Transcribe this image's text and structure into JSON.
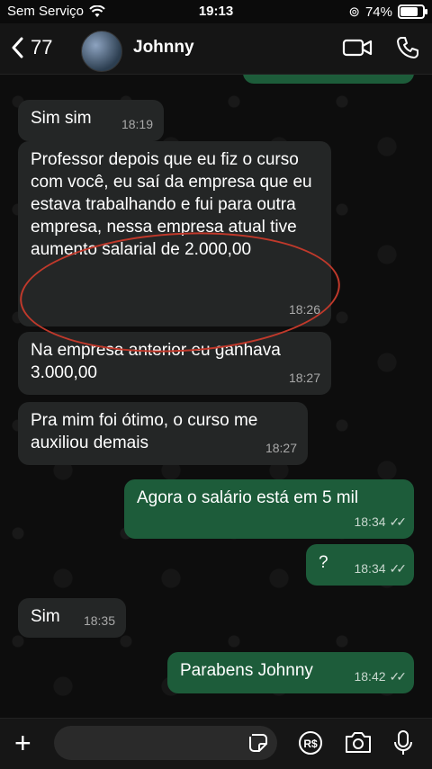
{
  "status_bar": {
    "carrier": "Sem Serviço",
    "time": "19:13",
    "battery": "74%",
    "battery_level": 0.74
  },
  "header": {
    "back_count": "77",
    "contact_name": "Johnny"
  },
  "messages": [
    {
      "direction": "in",
      "text": "Sim sim",
      "time": "18:19"
    },
    {
      "direction": "in",
      "text": "Professor depois que eu fiz o curso com você, eu saí da empresa que eu estava trabalhando e fui para outra empresa, nessa empresa atual tive aumento salarial de 2.000,00",
      "time": "18:26"
    },
    {
      "direction": "in",
      "text": "Na empresa anterior eu ganhava 3.000,00",
      "time": "18:27"
    },
    {
      "direction": "in",
      "text": "Pra mim foi ótimo, o curso me auxiliou demais",
      "time": "18:27"
    },
    {
      "direction": "out",
      "text": "Agora o salário está em 5 mil",
      "time": "18:34"
    },
    {
      "direction": "out",
      "text": "?",
      "time": "18:34"
    },
    {
      "direction": "in",
      "text": "Sim",
      "time": "18:35"
    },
    {
      "direction": "out",
      "text": "Parabens Johnny",
      "time": "18:42"
    }
  ],
  "input_bar": {
    "placeholder": "",
    "currency_icon_label": "R$"
  },
  "colors": {
    "incoming": "#242626",
    "outgoing": "#1d5c3a",
    "annotation": "#c0392b"
  }
}
